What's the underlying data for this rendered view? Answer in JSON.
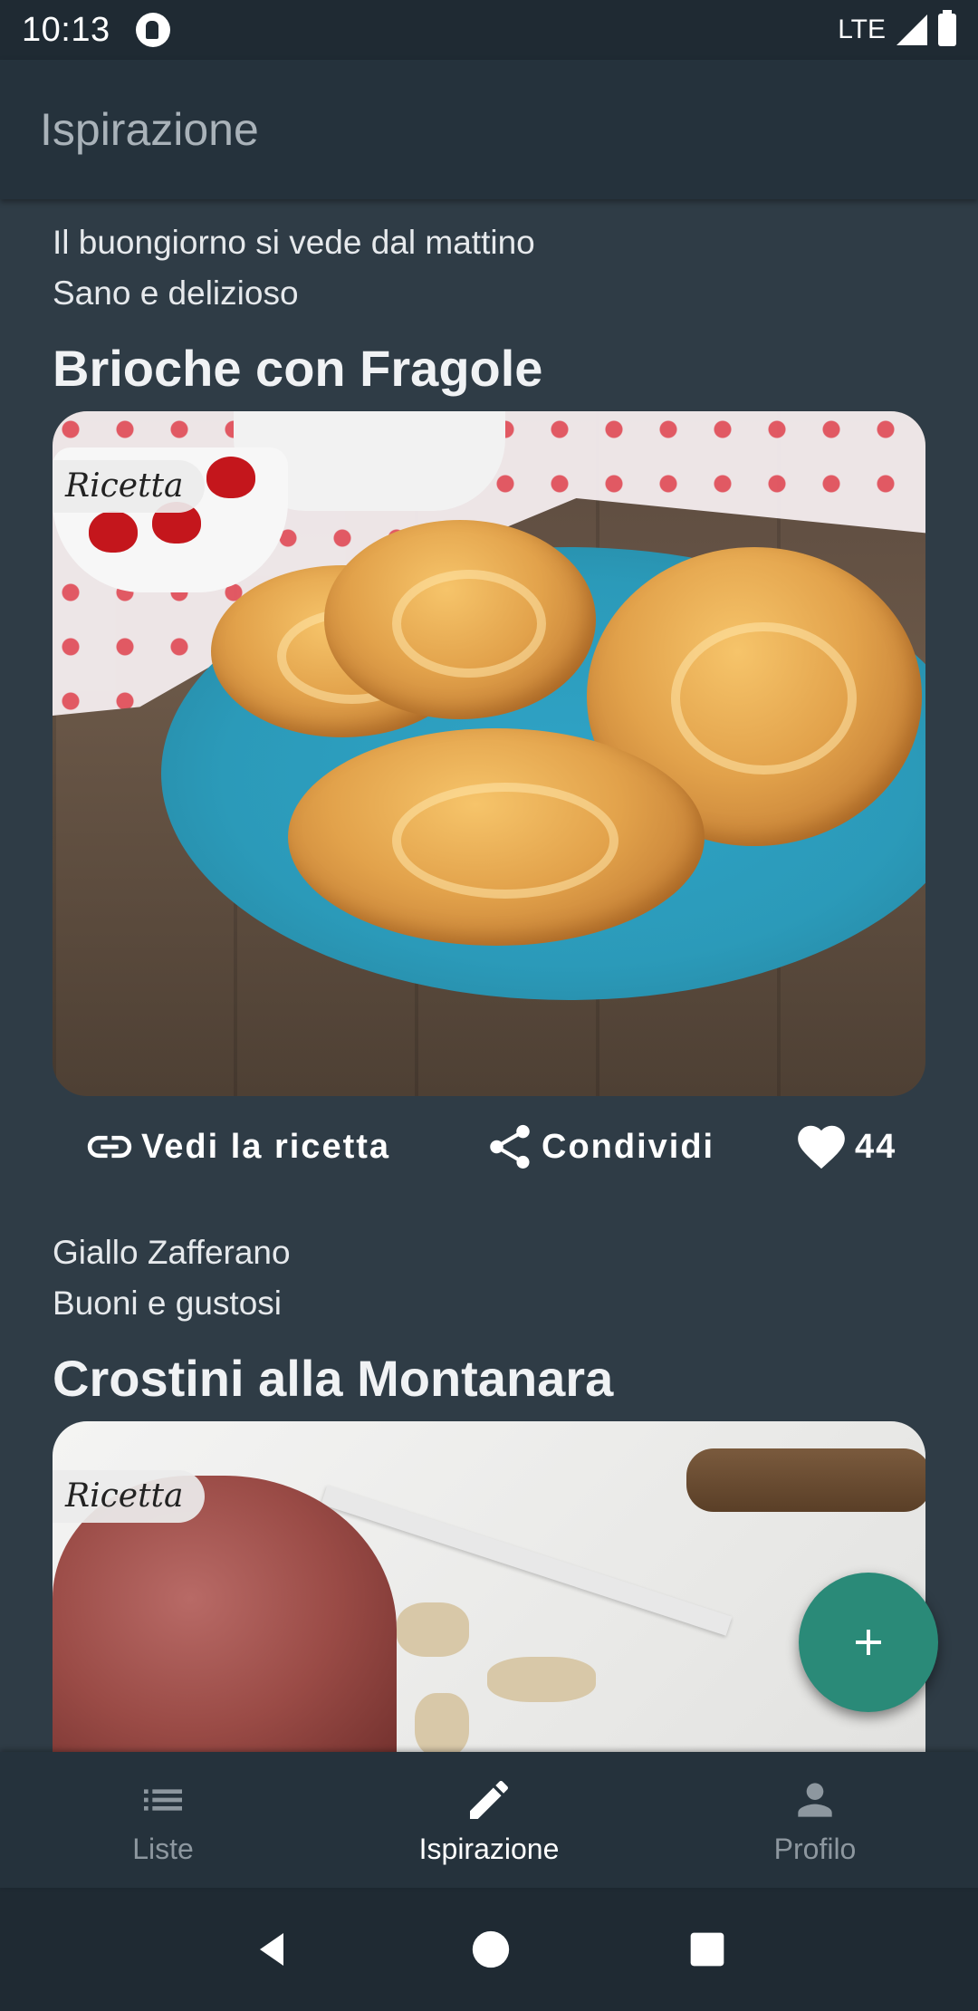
{
  "status_bar": {
    "time": "10:13",
    "network": "LTE"
  },
  "app_bar": {
    "title": "Ispirazione"
  },
  "cards": [
    {
      "source": "Il buongiorno si vede dal mattino",
      "subtitle": "Sano e delizioso",
      "title": "Brioche con Fragole",
      "tag": "Ricetta",
      "actions": {
        "view": "Vedi la ricetta",
        "share": "Condividi",
        "likes": "44"
      }
    },
    {
      "source": "Giallo Zafferano",
      "subtitle": "Buoni e gustosi",
      "title": "Crostini alla Montanara",
      "tag": "Ricetta"
    }
  ],
  "bottom_nav": {
    "items": [
      {
        "label": "Liste",
        "icon": "list-icon",
        "active": false
      },
      {
        "label": "Ispirazione",
        "icon": "pencil-icon",
        "active": true
      },
      {
        "label": "Profilo",
        "icon": "person-icon",
        "active": false
      }
    ]
  },
  "fab": {
    "icon": "plus-icon"
  },
  "colors": {
    "background": "#2f3c46",
    "app_bar": "#25323c",
    "fab": "#2a8a78",
    "nav_inactive": "#8d979f",
    "nav_active": "#ffffff"
  }
}
